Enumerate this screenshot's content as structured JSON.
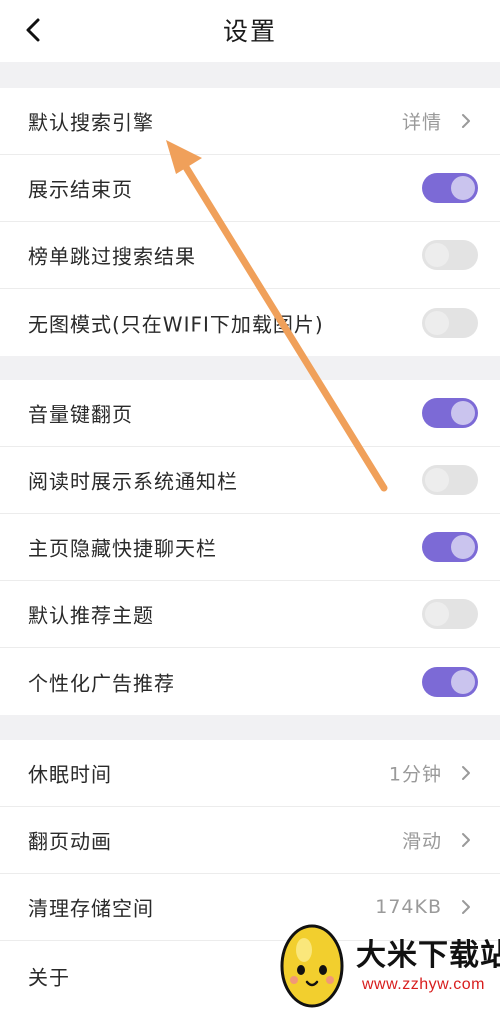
{
  "header": {
    "title": "设置"
  },
  "sections": [
    {
      "rows": [
        {
          "label": "默认搜索引擎",
          "value": "详情",
          "type": "link"
        },
        {
          "label": "展示结束页",
          "type": "toggle",
          "on": true
        },
        {
          "label": "榜单跳过搜索结果",
          "type": "toggle",
          "on": false
        },
        {
          "label": "无图模式(只在WIFI下加载图片)",
          "type": "toggle",
          "on": false
        }
      ]
    },
    {
      "rows": [
        {
          "label": "音量键翻页",
          "type": "toggle",
          "on": true
        },
        {
          "label": "阅读时展示系统通知栏",
          "type": "toggle",
          "on": false
        },
        {
          "label": "主页隐藏快捷聊天栏",
          "type": "toggle",
          "on": true
        },
        {
          "label": "默认推荐主题",
          "type": "toggle",
          "on": false
        },
        {
          "label": "个性化广告推荐",
          "type": "toggle",
          "on": true
        }
      ]
    },
    {
      "rows": [
        {
          "label": "休眠时间",
          "value": "1分钟",
          "type": "link"
        },
        {
          "label": "翻页动画",
          "value": "滑动",
          "type": "link"
        },
        {
          "label": "清理存储空间",
          "value": "174KB",
          "type": "link"
        },
        {
          "label": "关于",
          "type": "plain"
        }
      ]
    }
  ],
  "watermark": {
    "title": "大米下载站",
    "url": "www.zzhyw.com"
  },
  "colors": {
    "toggle_on": "#7c6ad6",
    "toggle_off": "#e3e3e3",
    "annotation_arrow": "#f0a05a"
  },
  "icons": [
    "back-arrow-icon",
    "chevron-right-icon",
    "annotation-arrow"
  ]
}
